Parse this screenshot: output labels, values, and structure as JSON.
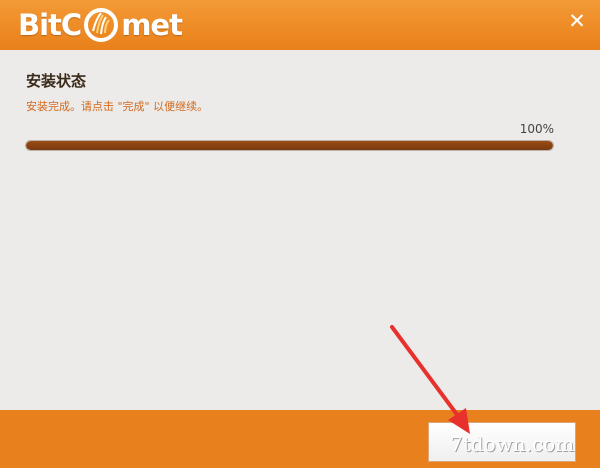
{
  "window": {
    "logo_left": "BitC",
    "logo_right": "met",
    "close_label": "✕"
  },
  "content": {
    "title": "安装状态",
    "message": "安装完成。请点击 \"完成\" 以便继续。",
    "progress_label": "100%",
    "progress_value": 1.0
  },
  "footer": {
    "finish_label": ""
  },
  "watermark": "7tdown.com",
  "colors": {
    "accent": "#e9801e",
    "progress_fill": "#7a3a0e",
    "annotation_arrow": "#e8302c"
  }
}
